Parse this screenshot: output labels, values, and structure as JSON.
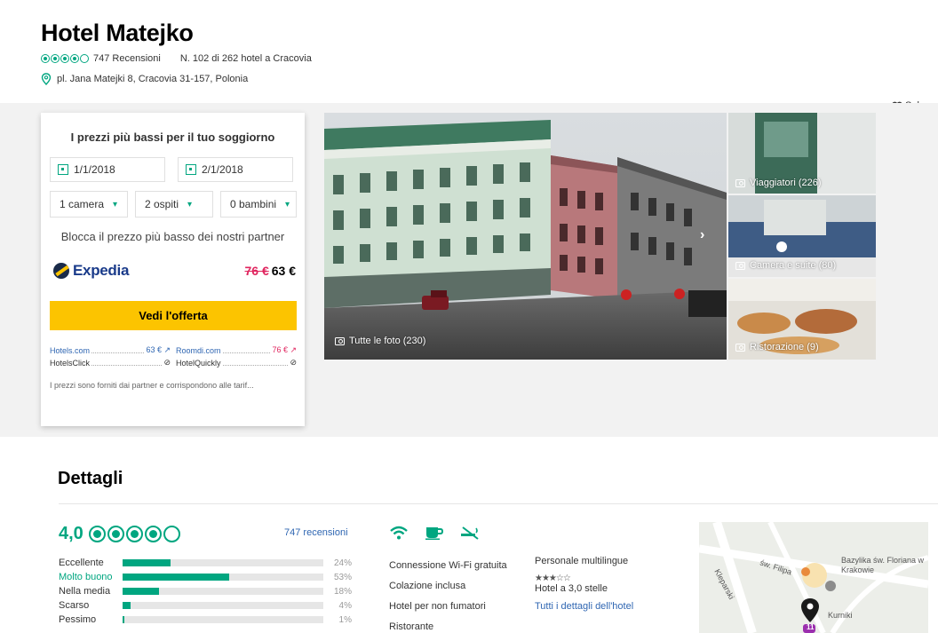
{
  "header": {
    "title": "Hotel Matejko",
    "reviews": "747 Recensioni",
    "rank": "N. 102 di 262 hotel a Cracovia",
    "address": "pl. Jana Matejki 8, Cracovia 31-157, Polonia",
    "save_label": "Salva",
    "bubble_rating": 4
  },
  "booking": {
    "title": "I prezzi più bassi per il tuo soggiorno",
    "checkin": "1/1/2018",
    "checkout": "2/1/2018",
    "rooms": "1 camera",
    "guests": "2 ospiti",
    "children": "0 bambini",
    "block_text": "Blocca il prezzo più basso dei nostri partner",
    "partner": "Expedia",
    "old_price": "76 €",
    "price": "63 €",
    "cta": "Vedi l'offerta",
    "partners": [
      {
        "name": "Hotels.com",
        "price": "63 € ↗"
      },
      {
        "name": "Roomdi.com",
        "price": "76 € ↗"
      },
      {
        "name": "HotelsClick",
        "price": "⊘"
      },
      {
        "name": "HotelQuickly",
        "price": "⊘"
      }
    ],
    "disclaimer": "I prezzi sono forniti dai partner e corrispondono alle tarif..."
  },
  "photos": {
    "main": "Tutte le foto (230)",
    "side1": "Viaggiatori (226)",
    "side2": "Camera e suite (80)",
    "side3": "Ristorazione (9)"
  },
  "details": {
    "title": "Dettagli",
    "score": "4,0",
    "reviews_link": "747 recensioni",
    "bars": [
      {
        "label": "Eccellente",
        "pct": "24%",
        "value": 24
      },
      {
        "label": "Molto buono",
        "pct": "53%",
        "value": 53
      },
      {
        "label": "Nella media",
        "pct": "18%",
        "value": 18
      },
      {
        "label": "Scarso",
        "pct": "4%",
        "value": 4
      },
      {
        "label": "Pessimo",
        "pct": "1%",
        "value": 1
      }
    ],
    "amenities": [
      "Connessione Wi-Fi gratuita",
      "Colazione inclusa",
      "Hotel per non fumatori",
      "Ristorante"
    ],
    "amenities2": {
      "languages": "Personale multilingue",
      "class": "Hotel a 3,0 stelle",
      "all_link": "Tutti i dettagli dell'hotel"
    }
  },
  "map": {
    "street": "św. Filipa",
    "street2": "Kleparski",
    "poi": "Bazylika św. Floriana w Krakowie",
    "poi2": "Kurniki",
    "bus_number": "11"
  },
  "colors": {
    "accent": "#00a680",
    "cta": "#fcc400",
    "price_red": "#e0245e",
    "link": "#2f66b2"
  }
}
